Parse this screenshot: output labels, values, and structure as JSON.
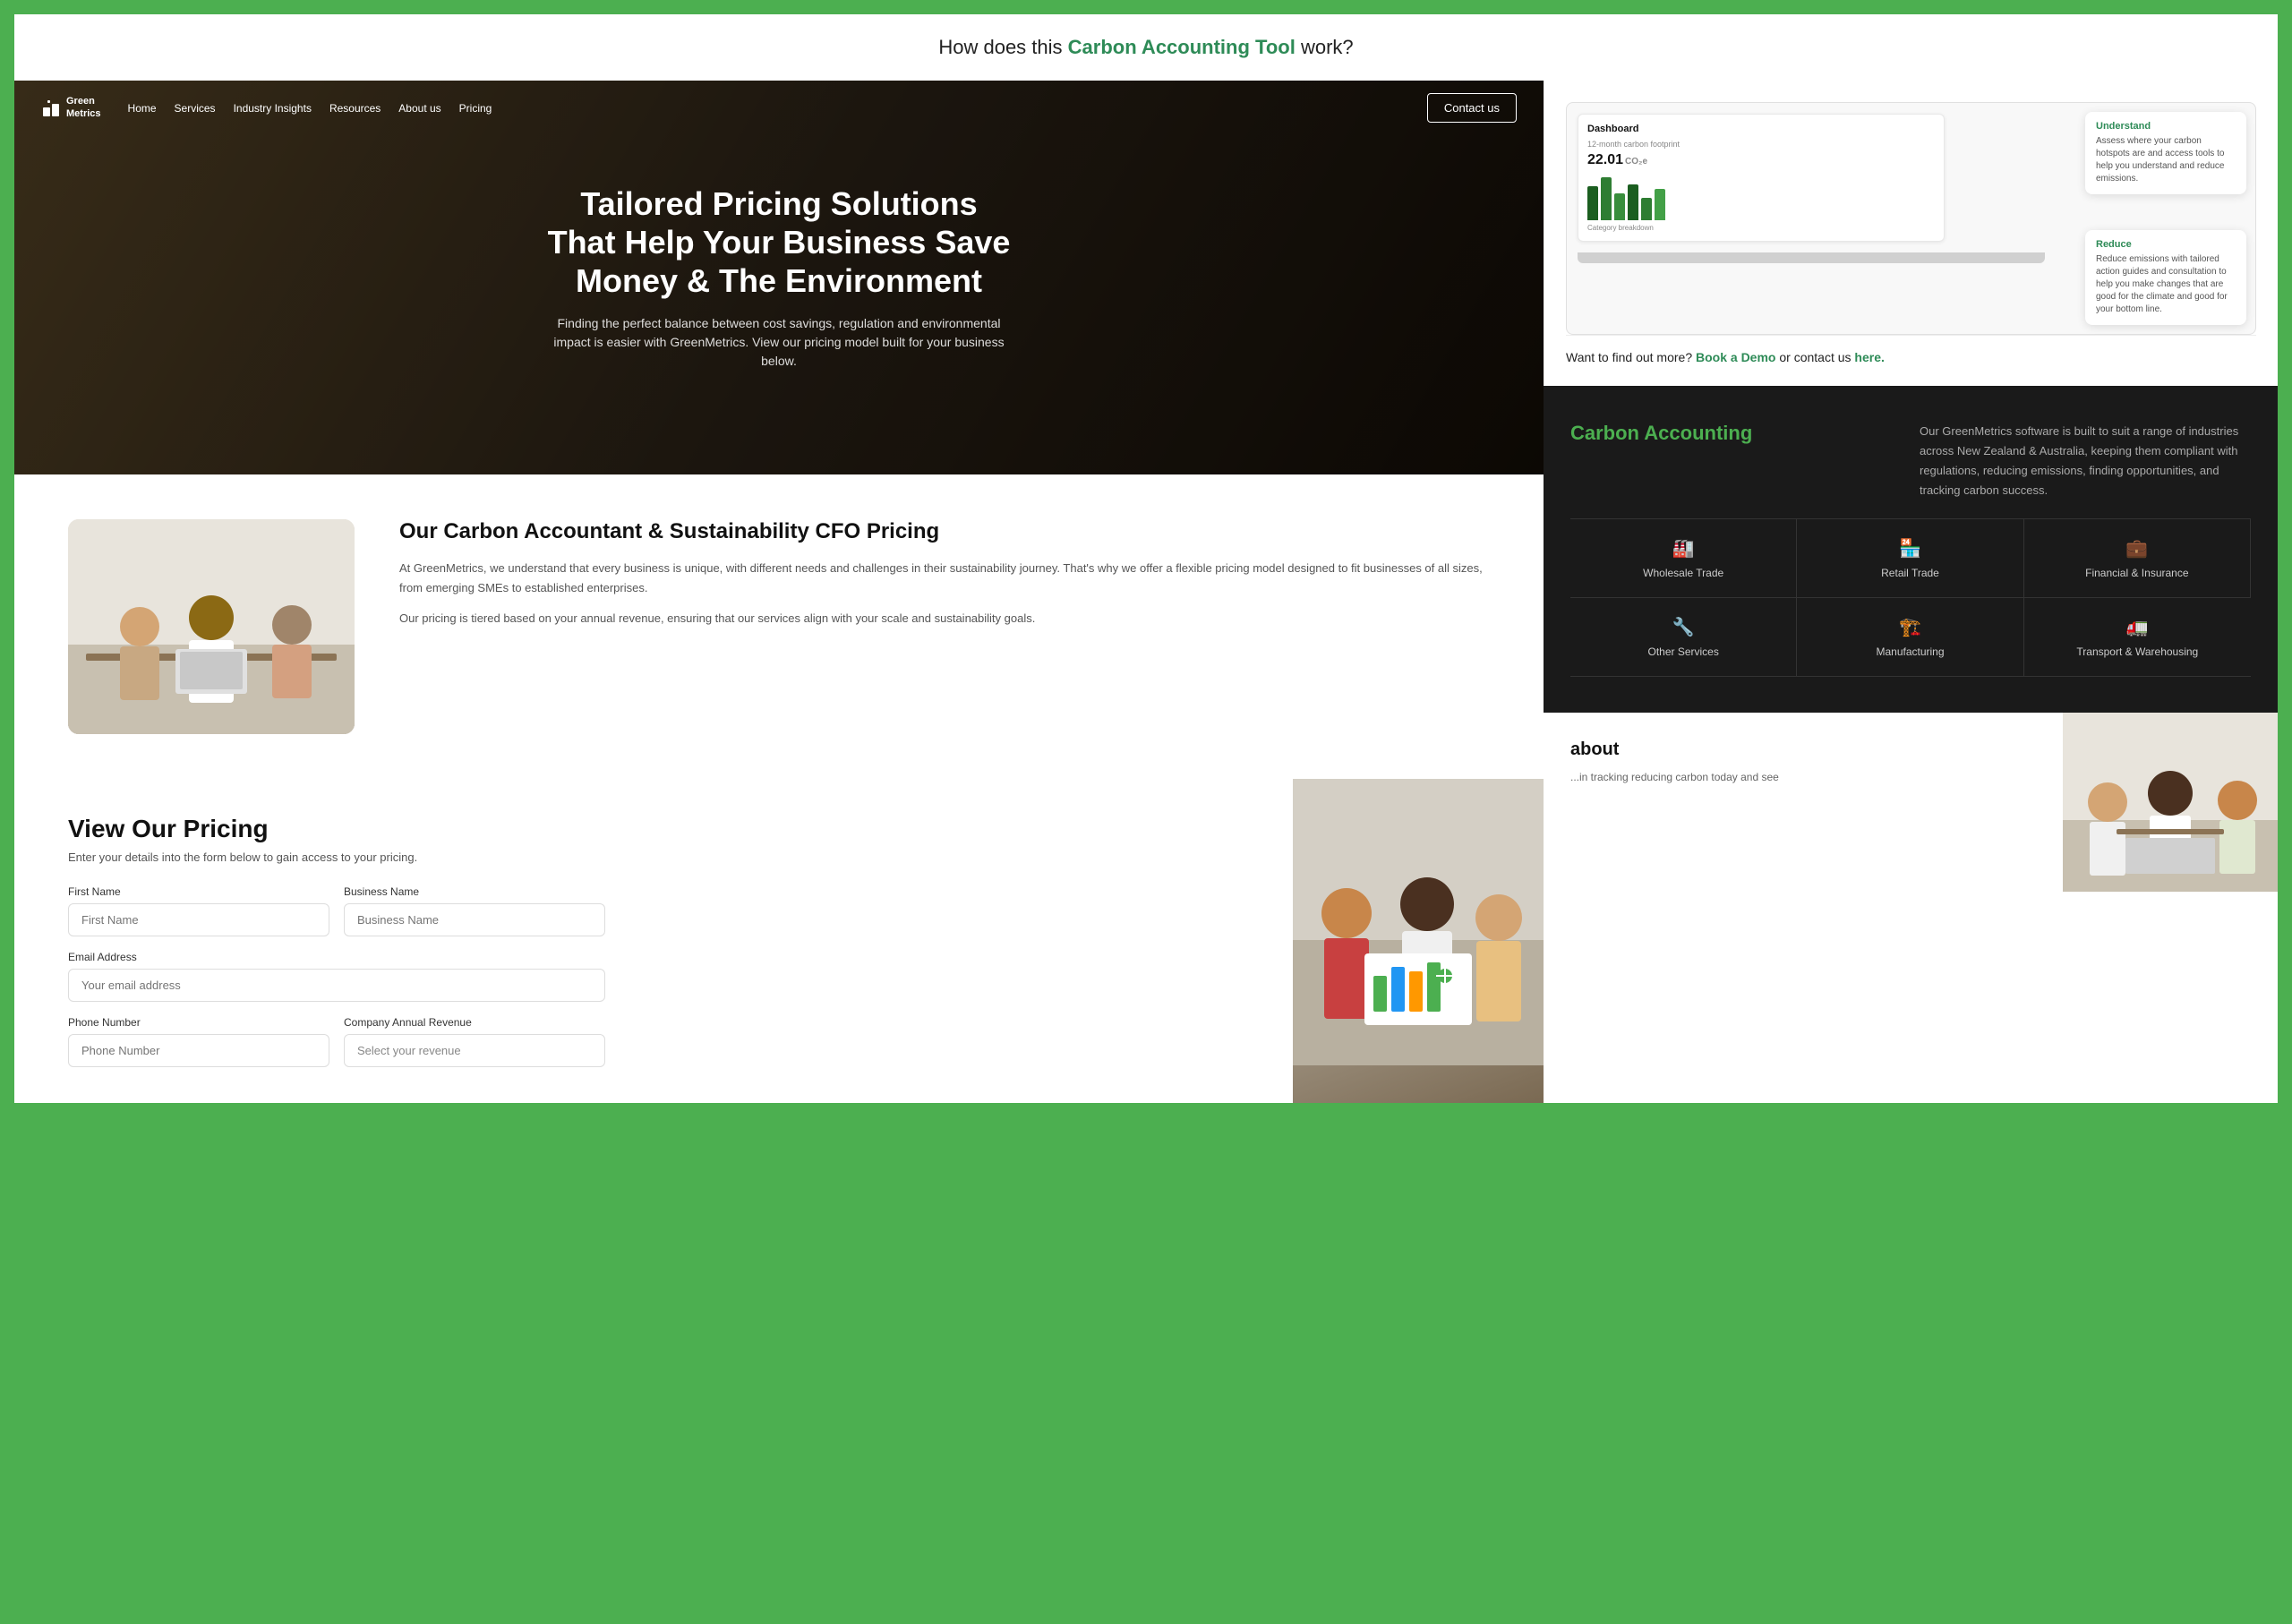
{
  "site": {
    "name": "GreenMetrics",
    "logo_symbol": "⬛"
  },
  "top_banner": {
    "text_before": "How does this ",
    "highlight": "Carbon Accounting Tool",
    "text_after": " work?"
  },
  "navbar": {
    "logo": "Green Metrics",
    "links": [
      "Home",
      "Services",
      "Industry Insights",
      "Resources",
      "About us",
      "Pricing"
    ],
    "contact_btn": "Contact us"
  },
  "hero": {
    "title": "Tailored Pricing Solutions That Help Your Business Save Money & The Environment",
    "subtitle": "Finding the perfect balance between cost savings, regulation and environmental impact is easier with GreenMetrics. View our pricing model built for your business below."
  },
  "carbon_accountant": {
    "title": "Our Carbon Accountant & Sustainability CFO Pricing",
    "para1": "At GreenMetrics, we understand that every business is unique, with different needs and challenges in their sustainability journey. That's why we offer a flexible pricing model designed to fit businesses of all sizes, from emerging SMEs to established enterprises.",
    "para2": "Our pricing is tiered based on your annual revenue, ensuring that our services align with your scale and sustainability goals."
  },
  "pricing": {
    "title": "View Our Pricing",
    "subtitle": "Enter your details into the form below to gain access to your pricing.",
    "form": {
      "first_name_label": "First Name",
      "first_name_placeholder": "First Name",
      "business_name_label": "Business Name",
      "business_name_placeholder": "Business Name",
      "email_label": "Email Address",
      "email_placeholder": "Your email address",
      "phone_label": "Phone Number",
      "phone_placeholder": "Phone Number",
      "revenue_label": "Company Annual Revenue",
      "revenue_placeholder": "Select your revenue"
    }
  },
  "dashboard": {
    "title": "Dashboard",
    "metric": "22.01",
    "metric_unit": "CO₂e",
    "subtitle": "12-month carbon footprint",
    "category_title": "Category breakdown",
    "bars": [
      {
        "height": 60,
        "color": "#2e7d32"
      },
      {
        "height": 80,
        "color": "#388e3c"
      },
      {
        "height": 45,
        "color": "#1b5e20"
      },
      {
        "height": 55,
        "color": "#2e7d32"
      },
      {
        "height": 40,
        "color": "#43a047"
      },
      {
        "height": 35,
        "color": "#388e3c"
      }
    ]
  },
  "callouts": {
    "understand": {
      "title": "Understand",
      "text": "Assess where your carbon hotspots are and access tools to help you understand and reduce emissions."
    },
    "reduce": {
      "title": "Reduce",
      "text": "Reduce emissions with tailored action guides and consultation to help you make changes that are good for the climate and good for your bottom line."
    }
  },
  "demo": {
    "text_before": "Want to find out more?",
    "link1": "Book a Demo",
    "text_mid": "or contact us",
    "link2": "here."
  },
  "dark_section": {
    "title": "Carbon Accounting",
    "text": "Our GreenMetrics software is built to suit a range of industries across New Zealand & Australia, keeping them compliant with regulations, reducing emissions, finding opportunities, and tracking carbon success."
  },
  "industries": [
    {
      "label": "Wholesale Trade",
      "icon": "🏭"
    },
    {
      "label": "Retail Trade",
      "icon": "🏪"
    },
    {
      "label": "Financial & Insurance",
      "icon": "💼"
    },
    {
      "label": "Other Services",
      "icon": "🔧"
    },
    {
      "label": "Manufacturing",
      "icon": "🏗️"
    },
    {
      "label": "Transport & Warehousing",
      "icon": "🚛"
    }
  ],
  "about_section": {
    "title": "about",
    "text": "...in tracking reducing carbon today and see"
  }
}
